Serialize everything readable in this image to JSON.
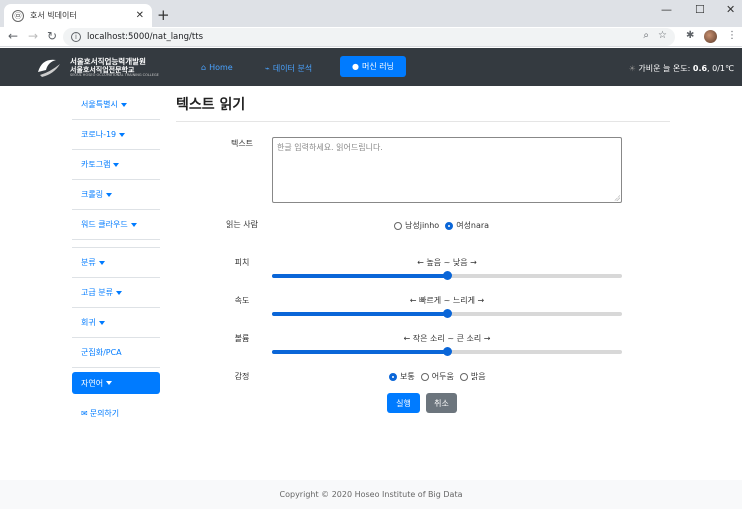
{
  "browser": {
    "tab_title": "호서 빅데이터",
    "url": "localhost:5000/nat_lang/tts",
    "new_tab": "+",
    "close": "✕",
    "minimize": "—",
    "maximize": "☐",
    "win_close": "✕"
  },
  "navbar": {
    "logo_line1": "서울호서직업능력개발원",
    "logo_line2": "서울호서직업전문학교",
    "logo_line3": "SEOUL HOSEO OCCUPATIONAL TRAINING COLLEGE",
    "links": [
      "Home",
      "데이터 분석",
      "머신 러닝"
    ],
    "weather_label": "가비운 늘 온도:",
    "weather_temp": "0.6",
    "weather_rest": ", 0/1℃"
  },
  "sidebar": {
    "items": [
      "서울특별시",
      "코로나-19",
      "카토그램",
      "크롤링",
      "워드 클라우드",
      "분류",
      "고급 분류",
      "회귀",
      "군집화/PCA",
      "자연어",
      "문의하기"
    ]
  },
  "main": {
    "title": "텍스트 읽기",
    "text_label": "텍스트",
    "text_placeholder": "한글 입력하세요. 읽어드립니다.",
    "reader_label": "읽는 사람",
    "reader_options": [
      "남성jinho",
      "여성nara"
    ],
    "reader_selected": "여성nara",
    "pitch_label": "피치",
    "pitch_hint": "← 높음 ~ 낮음 →",
    "pitch_value": 0.5,
    "speed_label": "속도",
    "speed_hint": "← 빠르게 ~ 느리게 →",
    "speed_value": 0.5,
    "volume_label": "볼륨",
    "volume_hint": "← 작은 소리 ~ 큰 소리 →",
    "volume_value": 0.5,
    "emotion_label": "감정",
    "emotion_options": [
      "보통",
      "어두움",
      "밝음"
    ],
    "emotion_selected": "보통",
    "run_label": "실행",
    "cancel_label": "취소"
  },
  "footer": {
    "copyright": "Copyright © 2020 Hoseo Institute of Big Data"
  },
  "colors": {
    "primary": "#007bff",
    "navbar_bg": "#343a40",
    "slider_fill": "#0a66d8",
    "secondary": "#6c757d"
  }
}
